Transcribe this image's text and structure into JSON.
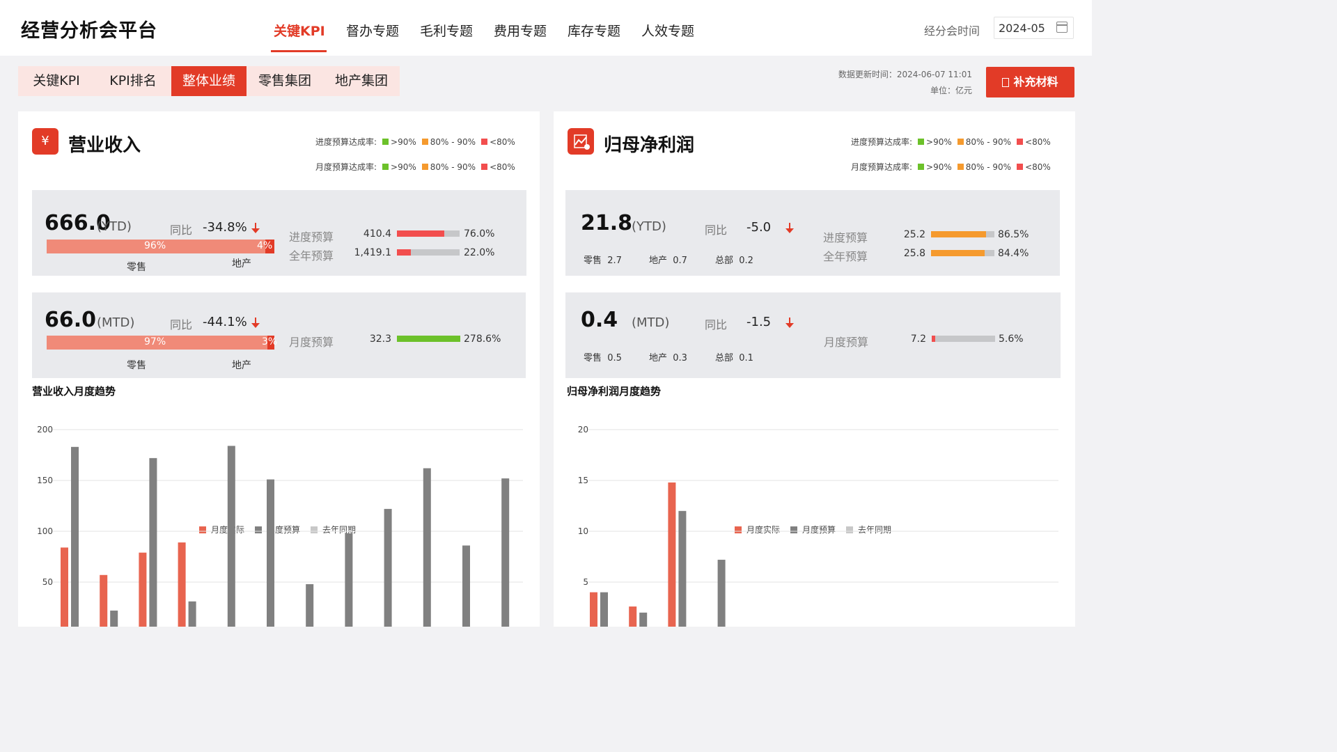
{
  "app": {
    "title": "经营分析会平台"
  },
  "nav": {
    "items": [
      {
        "label": "关键KPI",
        "active": true
      },
      {
        "label": "督办专题",
        "active": false
      },
      {
        "label": "毛利专题",
        "active": false
      },
      {
        "label": "费用专题",
        "active": false
      },
      {
        "label": "库存专题",
        "active": false
      },
      {
        "label": "人效专题",
        "active": false
      }
    ]
  },
  "meeting": {
    "label": "经分会时间",
    "date": "2024-05"
  },
  "subtabs": [
    {
      "label": "关键KPI",
      "active": false
    },
    {
      "label": "KPI排名",
      "active": false
    },
    {
      "label": "整体业绩",
      "active": true
    },
    {
      "label": "零售集团",
      "active": false
    },
    {
      "label": "地产集团",
      "active": false
    }
  ],
  "update": {
    "time": "数据更新时间：2024-06-07 11:01",
    "unit": "单位：亿元"
  },
  "supplement_button": "补充材料",
  "legends": {
    "progress_label": "进度预算达成率:",
    "monthly_label": "月度预算达成率:",
    "items": [
      ">90%",
      "80% - 90%",
      "<80%"
    ]
  },
  "colors": {
    "accent": "#e23b27",
    "green": "#6cc12a",
    "orange": "#f59a2e",
    "red": "#f24e4e",
    "grey": "#808080",
    "light_grey": "#c8c8c8",
    "actual": "#e8644f"
  },
  "revenue": {
    "title": "营业收入",
    "icon": "yuan-icon",
    "ytd": {
      "value": "666.0",
      "tag": "(YTD)",
      "yoy_label": "同比",
      "yoy": "-34.8%",
      "retail_pct": "96%",
      "estate_pct": "4%",
      "retail_label": "零售",
      "estate_label": "地产",
      "retail_share": 0.96,
      "progress": {
        "label": "进度预算",
        "value": "410.4",
        "pct": "76.0%",
        "ratio": 0.76,
        "color": "red"
      },
      "annual": {
        "label": "全年预算",
        "value": "1,419.1",
        "pct": "22.0%",
        "ratio": 0.22,
        "color": "red"
      }
    },
    "mtd": {
      "value": "66.0",
      "tag": "(MTD)",
      "yoy_label": "同比",
      "yoy": "-44.1%",
      "retail_pct": "97%",
      "estate_pct": "3%",
      "retail_label": "零售",
      "estate_label": "地产",
      "retail_share": 0.97,
      "monthly": {
        "label": "月度预算",
        "value": "32.3",
        "pct": "278.6%",
        "ratio": 1.0,
        "color": "green"
      }
    },
    "chart_title": "营业收入月度趋势"
  },
  "profit": {
    "title": "归母净利润",
    "icon": "profit-chart-icon",
    "ytd": {
      "value": "21.8",
      "tag": "(YTD)",
      "yoy_label": "同比",
      "yoy": "-5.0",
      "retail_label": "零售",
      "retail": "2.7",
      "estate_label": "地产",
      "estate": "0.7",
      "hq_label": "总部",
      "hq": "0.2",
      "progress": {
        "label": "进度预算",
        "value": "25.2",
        "pct": "86.5%",
        "ratio": 0.865,
        "color": "orange"
      },
      "annual": {
        "label": "全年预算",
        "value": "25.8",
        "pct": "84.4%",
        "ratio": 0.844,
        "color": "orange"
      }
    },
    "mtd": {
      "value": "0.4",
      "tag": "(MTD)",
      "yoy_label": "同比",
      "yoy": "-1.5",
      "retail_label": "零售",
      "retail": "0.5",
      "estate_label": "地产",
      "estate": "0.3",
      "hq_label": "总部",
      "hq": "0.1",
      "monthly": {
        "label": "月度预算",
        "value": "7.2",
        "pct": "5.6%",
        "ratio": 0.056,
        "color": "red"
      }
    },
    "chart_title": "归母净利润月度趋势"
  },
  "chart_data": [
    {
      "type": "bar",
      "legend": [
        "月度实际",
        "月度预算",
        "去年同期"
      ],
      "ylim": [
        0,
        200
      ],
      "yticks": [
        50,
        100,
        150,
        200
      ],
      "grid": true,
      "legend_position": "top-center",
      "series": [
        {
          "name": "月度实际",
          "values": [
            84,
            57,
            79,
            89,
            0,
            0,
            0,
            0,
            0,
            0,
            0,
            0
          ]
        },
        {
          "name": "月度预算",
          "values": [
            183,
            22,
            172,
            31,
            184,
            151,
            48,
            98,
            122,
            162,
            86,
            152
          ]
        },
        {
          "name": "去年同期",
          "values": [
            0,
            0,
            0,
            0,
            0,
            0,
            0,
            0,
            0,
            0,
            0,
            0
          ]
        }
      ]
    },
    {
      "type": "bar",
      "legend": [
        "月度实际",
        "月度预算",
        "去年同期"
      ],
      "ylim": [
        0,
        20
      ],
      "yticks": [
        5,
        10,
        15,
        20
      ],
      "grid": true,
      "legend_position": "top-center",
      "series": [
        {
          "name": "月度实际",
          "values": [
            4,
            2.6,
            14.8,
            0,
            0,
            0,
            0,
            0,
            0,
            0,
            0,
            0
          ]
        },
        {
          "name": "月度预算",
          "values": [
            4,
            2,
            12,
            7.2,
            0,
            0,
            0,
            0,
            0,
            0,
            0,
            0
          ]
        },
        {
          "name": "去年同期",
          "values": [
            0,
            0,
            0,
            0,
            0,
            0,
            0,
            0,
            0,
            0,
            0,
            0
          ]
        }
      ]
    }
  ]
}
